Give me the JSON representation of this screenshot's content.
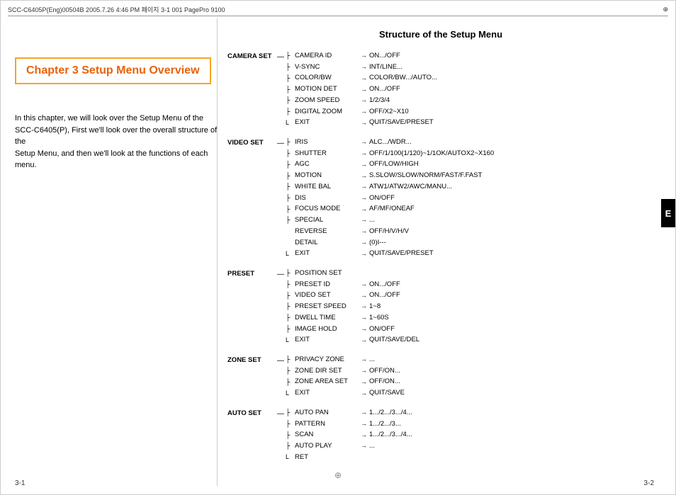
{
  "header": {
    "left_text": "SCC-C6405P(Eng)00504B  2005.7.26 4:46 PM 페이지 3-1   001 PagePro 9100",
    "crosshair": "⊕"
  },
  "side_tab": "E",
  "chapter": {
    "title": "Chapter 3  Setup Menu Overview",
    "description_line1": "In this chapter, we will look over the Setup Menu of the",
    "description_line2": "SCC-C6405(P), First we'll look over the overall structure of the",
    "description_line3": "Setup Menu, and then we'll look at the functions of each menu."
  },
  "structure_title": "Structure of the Setup Menu",
  "menu_groups": [
    {
      "label": "CAMERA SET",
      "items": [
        {
          "name": "CAMERA ID",
          "value": "ON.../OFF"
        },
        {
          "name": "V-SYNC",
          "value": "INT/LINE..."
        },
        {
          "name": "COLOR/BW",
          "value": "COLOR/BW.../AUTO..."
        },
        {
          "name": "MOTION DET",
          "value": "ON.../OFF"
        },
        {
          "name": "ZOOM SPEED",
          "value": "1/2/3/4"
        },
        {
          "name": "DIGITAL ZOOM",
          "value": "OFF/X2~X10"
        },
        {
          "name": "EXIT",
          "value": "QUIT/SAVE/PRESET"
        }
      ]
    },
    {
      "label": "VIDEO SET",
      "items": [
        {
          "name": "IRIS",
          "value": "ALC.../WDR..."
        },
        {
          "name": "SHUTTER",
          "value": "OFF/1/100(1/120)~1/1OK/AUTOX2~X160"
        },
        {
          "name": "AGC",
          "value": "OFF/LOW/HIGH"
        },
        {
          "name": "MOTION",
          "value": "S.SLOW/SLOW/NORM/FAST/F.FAST"
        },
        {
          "name": "WHITE BAL",
          "value": "ATW1/ATW2/AWC/MANU..."
        },
        {
          "name": "DIS",
          "value": "ON/OFF"
        },
        {
          "name": "FOCUS MODE",
          "value": "AF/MF/ONEAF"
        },
        {
          "name": "SPECIAL",
          "value": "..."
        },
        {
          "name": "  REVERSE",
          "value": "OFF/H/V/H/V",
          "indent": true
        },
        {
          "name": "  DETAIL",
          "value": "(0)I---",
          "indent": true
        },
        {
          "name": "EXIT",
          "value": "QUIT/SAVE/PRESET"
        }
      ]
    },
    {
      "label": "PRESET",
      "items": [
        {
          "name": "POSITION SET",
          "value": ""
        },
        {
          "name": "PRESET ID",
          "value": "ON.../OFF"
        },
        {
          "name": "VIDEO SET",
          "value": "ON.../OFF"
        },
        {
          "name": "PRESET SPEED",
          "value": "1~8"
        },
        {
          "name": "DWELL TIME",
          "value": "1~60S"
        },
        {
          "name": "IMAGE HOLD",
          "value": "ON/OFF"
        },
        {
          "name": "EXIT",
          "value": "QUIT/SAVE/DEL"
        }
      ]
    },
    {
      "label": "ZONE SET",
      "items": [
        {
          "name": "PRIVACY ZONE",
          "value": "..."
        },
        {
          "name": "ZONE DIR SET",
          "value": "OFF/ON..."
        },
        {
          "name": "ZONE AREA SET",
          "value": "OFF/ON..."
        },
        {
          "name": "EXIT",
          "value": "QUIT/SAVE"
        }
      ]
    },
    {
      "label": "AUTO SET",
      "items": [
        {
          "name": "AUTO PAN",
          "value": "1.../2.../3.../4..."
        },
        {
          "name": "PATTERN",
          "value": "1.../2.../3..."
        },
        {
          "name": "SCAN",
          "value": "1.../2.../3.../4..."
        },
        {
          "name": "AUTO PLAY",
          "value": "..."
        },
        {
          "name": "RET",
          "value": ""
        }
      ]
    }
  ],
  "page_numbers": {
    "left": "3-1",
    "right": "3-2"
  }
}
